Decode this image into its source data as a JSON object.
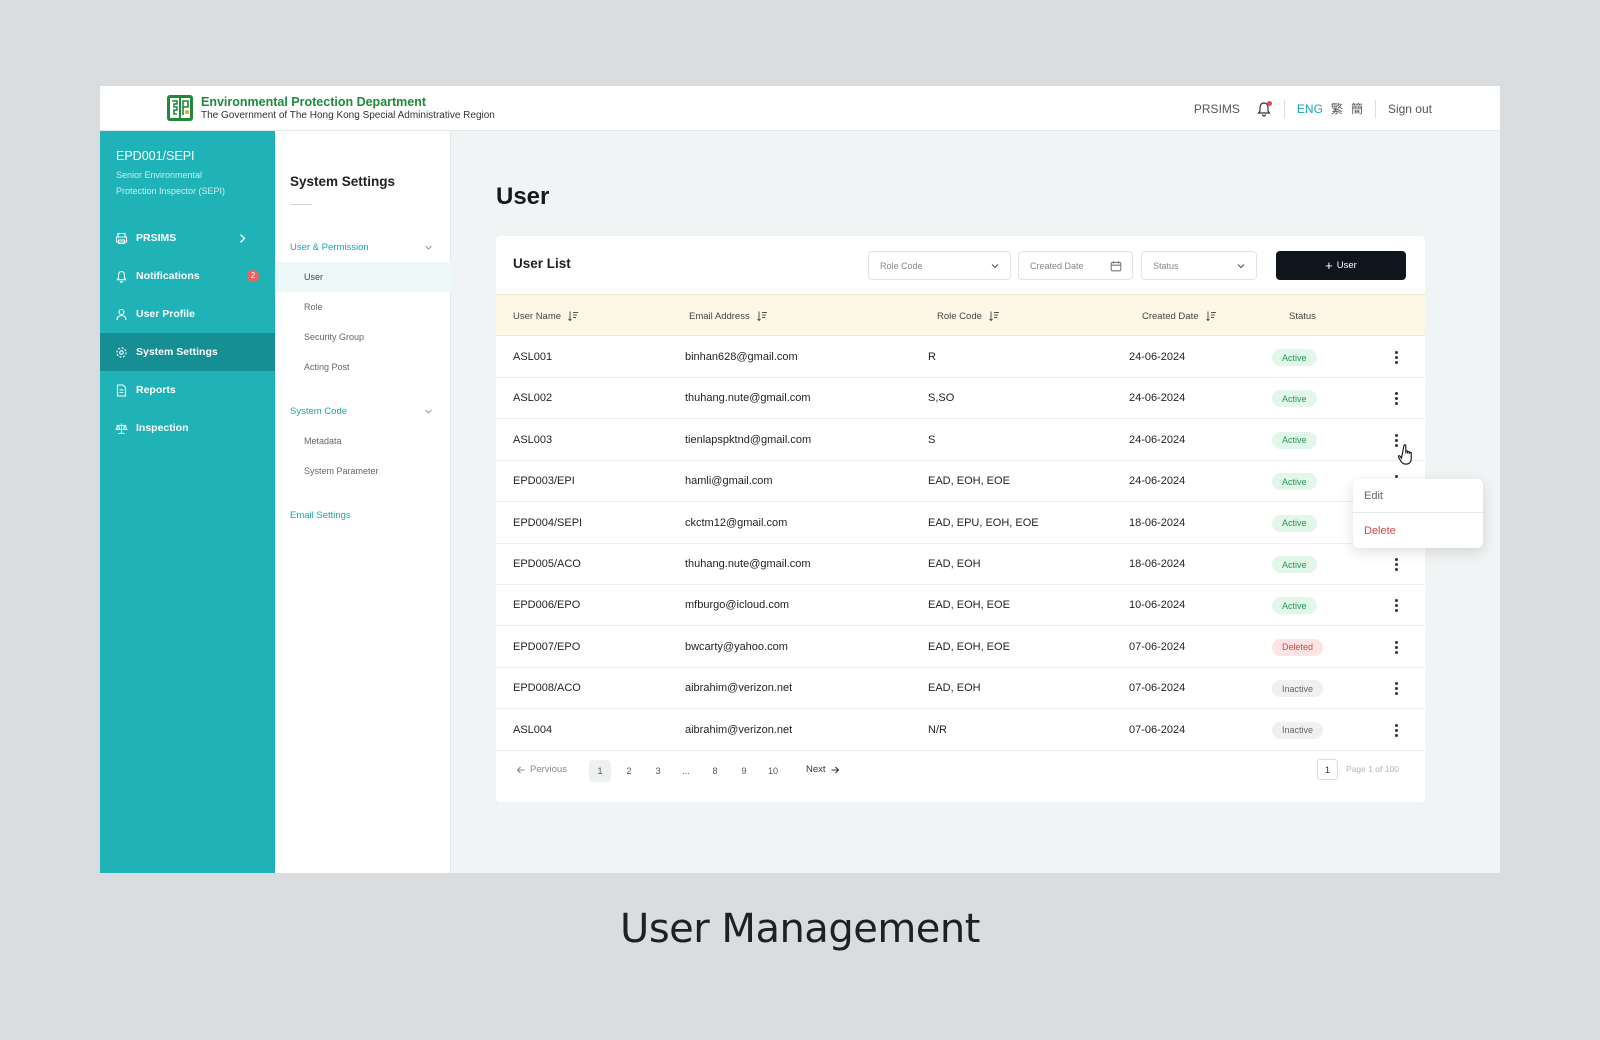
{
  "topbar": {
    "brand_name": "Environmental Protection Department",
    "brand_sub": "The Government of The Hong Kong Special Administrative Region",
    "prsims": "PRSIMS",
    "lang_eng": "ENG",
    "lang_tc": "繁",
    "lang_sc": "簡",
    "sign_out": "Sign out"
  },
  "sidebar": {
    "user_id": "EPD001/SEPI",
    "user_role": "Senior Environmental Protection Inspector (SEPI)",
    "items": [
      {
        "label": "PRSIMS",
        "icon": "printer-icon"
      },
      {
        "label": "Notifications",
        "icon": "bell-icon",
        "badge": "2"
      },
      {
        "label": "User Profile",
        "icon": "user-icon"
      },
      {
        "label": "System Settings",
        "icon": "gear-icon"
      },
      {
        "label": "Reports",
        "icon": "document-icon"
      },
      {
        "label": "Inspection",
        "icon": "scale-icon"
      }
    ]
  },
  "subnav": {
    "title": "System Settings",
    "group1": "User & Permission",
    "group1_items": [
      "User",
      "Role",
      "Security Group",
      "Acting Post"
    ],
    "group2": "System Code",
    "group2_items": [
      "Metadata",
      "System Parameter"
    ],
    "group3": "Email Settings"
  },
  "main": {
    "page_title": "User",
    "card_title": "User List",
    "filters": {
      "role_code": "Role Code",
      "created_date": "Created Date",
      "status": "Status"
    },
    "add_button": "User",
    "columns": [
      "User Name",
      "Email Address",
      "Role Code",
      "Created Date",
      "Status"
    ],
    "rows": [
      [
        "ASL001",
        "binhan628@gmail.com",
        "R",
        "24-06-2024",
        "Active"
      ],
      [
        "ASL002",
        "thuhang.nute@gmail.com",
        "S,SO",
        "24-06-2024",
        "Active"
      ],
      [
        "ASL003",
        "tienlapspktnd@gmail.com",
        "S",
        "24-06-2024",
        "Active"
      ],
      [
        "EPD003/EPI",
        "hamli@gmail.com",
        "EAD, EOH, EOE",
        "24-06-2024",
        "Active"
      ],
      [
        "EPD004/SEPI",
        "ckctm12@gmail.com",
        "EAD, EPU, EOH, EOE",
        "18-06-2024",
        "Active"
      ],
      [
        "EPD005/ACO",
        "thuhang.nute@gmail.com",
        "EAD, EOH",
        "18-06-2024",
        "Active"
      ],
      [
        "EPD006/EPO",
        "mfburgo@icloud.com",
        "EAD, EOH, EOE",
        "10-06-2024",
        "Active"
      ],
      [
        "EPD007/EPO",
        "bwcarty@yahoo.com",
        "EAD, EOH, EOE",
        "07-06-2024",
        "Deleted"
      ],
      [
        "EPD008/ACO",
        "aibrahim@verizon.net",
        "EAD, EOH",
        "07-06-2024",
        "Inactive"
      ],
      [
        "ASL004",
        "aibrahim@verizon.net",
        "N/R",
        "07-06-2024",
        "Inactive"
      ]
    ],
    "pagination": {
      "previous": "Pervious",
      "next": "Next",
      "pages": [
        "1",
        "2",
        "3",
        "...",
        "8",
        "9",
        "10"
      ],
      "current_box": "1",
      "info": "Page 1 of 100"
    },
    "menu": {
      "edit": "Edit",
      "delete": "Delete"
    }
  },
  "caption": "User Management",
  "colors": {
    "accent": "#1fb2b6",
    "brand_green": "#1f8a3c",
    "active_nav": "#158f94",
    "primary_button": "#0f151c"
  }
}
